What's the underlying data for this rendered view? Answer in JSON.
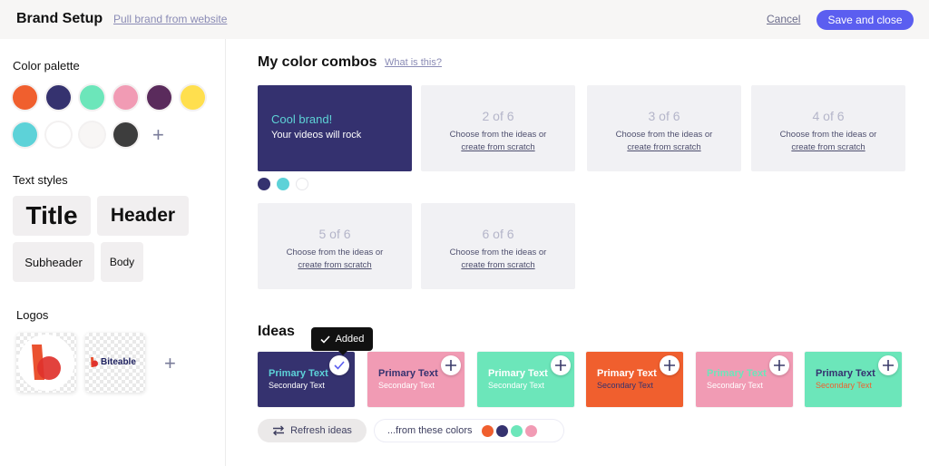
{
  "header": {
    "title": "Brand Setup",
    "pull_link": "Pull brand from website",
    "cancel": "Cancel",
    "save": "Save and close"
  },
  "sidebar": {
    "palette_label": "Color palette",
    "palette": [
      "#f05f2e",
      "#35326f",
      "#6ce6ba",
      "#f19bb4",
      "#5a2b5c",
      "#ffdf4e",
      "#5dd2d8",
      "#ffffff",
      "#f8f6f5",
      "#3d3d3d"
    ],
    "text_styles_label": "Text styles",
    "text_styles": [
      "Title",
      "Header",
      "Subheader",
      "Body"
    ],
    "logos_label": "Logos",
    "logo_wordmark": "Biteable"
  },
  "combos": {
    "title": "My color combos",
    "help_link": "What is this?",
    "filled": {
      "primary": "Cool brand!",
      "secondary": "Your videos will rock",
      "bg": "#35326f",
      "primary_color": "#5ed3d6",
      "secondary_color": "#ffffff",
      "dots": [
        "#35326f",
        "#5dd2d8",
        "#ffffff"
      ]
    },
    "slots": [
      {
        "num": "2 of 6",
        "hint": "Choose from the ideas or",
        "link": "create from scratch"
      },
      {
        "num": "3 of 6",
        "hint": "Choose from the ideas or",
        "link": "create from scratch"
      },
      {
        "num": "4 of 6",
        "hint": "Choose from the ideas or",
        "link": "create from scratch"
      },
      {
        "num": "5 of 6",
        "hint": "Choose from the ideas or",
        "link": "create from scratch"
      },
      {
        "num": "6 of 6",
        "hint": "Choose from the ideas or",
        "link": "create from scratch"
      }
    ]
  },
  "ideas": {
    "title": "Ideas",
    "tooltip": "Added",
    "items": [
      {
        "primary": "Primary Text",
        "secondary": "Secondary Text",
        "bg": "#35326f",
        "pc": "#5dd2d8",
        "sc": "#ffffff",
        "state": "added"
      },
      {
        "primary": "Primary Text",
        "secondary": "Secondary Text",
        "bg": "#f19bb4",
        "pc": "#35326f",
        "sc": "#ffffff",
        "state": "add"
      },
      {
        "primary": "Primary Text",
        "secondary": "Secondary Text",
        "bg": "#6ce6ba",
        "pc": "#ffffff",
        "sc": "#ffffff",
        "state": "add"
      },
      {
        "primary": "Primary Text",
        "secondary": "Secondary Text",
        "bg": "#f05f2e",
        "pc": "#ffffff",
        "sc": "#35326f",
        "state": "add"
      },
      {
        "primary": "Primary Text",
        "secondary": "Secondary Text",
        "bg": "#f19bb4",
        "pc": "#6ce6ba",
        "sc": "#ffffff",
        "state": "add"
      },
      {
        "primary": "Primary Text",
        "secondary": "Secondary Text",
        "bg": "#6ce6ba",
        "pc": "#35326f",
        "sc": "#f05f2e",
        "state": "add"
      }
    ],
    "refresh": "Refresh ideas",
    "from_colors": "...from these colors",
    "from_dots": [
      "#f05f2e",
      "#35326f",
      "#6ce6ba",
      "#f19bb4"
    ]
  }
}
